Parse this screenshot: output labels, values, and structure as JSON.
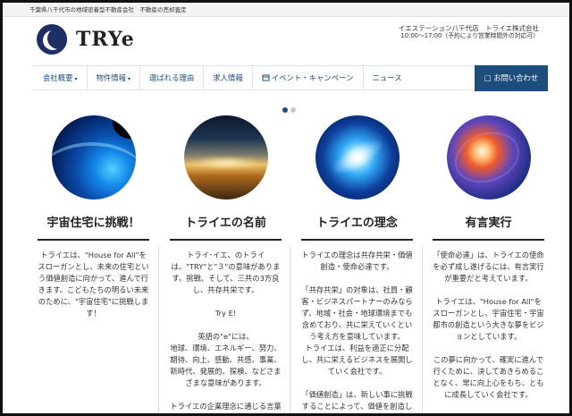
{
  "topbar": {
    "text": "千葉県八千代市の地域密着型不動産会社　不動産の売却査定"
  },
  "header": {
    "logo_text": "TRYe",
    "company_line1": "イエステーション八千代店　トライエ株式会社",
    "company_line2": "10:00～17:00（予約により営業時間外の対応可）"
  },
  "nav": {
    "items": [
      {
        "label": "会社概要",
        "caret": "▾"
      },
      {
        "label": "物件情報",
        "caret": "▾"
      },
      {
        "label": "選ばれる理由"
      },
      {
        "label": "求人情報"
      },
      {
        "label": "イベント・キャンペーン"
      },
      {
        "label": "ニュース"
      }
    ],
    "contact_label": "□ お問い合わせ"
  },
  "icons": {
    "calendar": "calendar-icon",
    "mail": "mail-icon"
  },
  "slider": {
    "active_index": 0
  },
  "columns": [
    {
      "title": "宇宙住宅に挑戦！",
      "body": "トライエは、\"House for All\"をスローガンとし、未来の住宅という価値創造に向かって、進んで行きます。こどもたちの明るい未来のために、\"宇宙住宅\"に挑戦します！"
    },
    {
      "title": "トライエの名前",
      "body": "トライ･イエ、のトライは、\"TRY\"と\"３\"の意味があります。挑戦、そして、三共の3方良し、共存共栄です。\n\nTry E!\n\n英語の\"e\"には、\n地球、環境、エネルギー、努力、期待、向上、感動、共感、事業、新時代、発展的、探検、などさまざまな意味があります。\n\nトライエの企業理念に通じる言葉の数多くが、\"e\"にあります。"
    },
    {
      "title": "トライエの理念",
      "body": "トライエの理念は共存共栄・価値創造・使命必達です。\n\n「共存共栄」の対象は、社員・顧客・ビジネスパートナーのみならず、地域・社会・地球環境までも含めており、共に栄えていくという考え方を意味しています。\nトライエは、利益を適正に分配し、共に栄えるビジネスを展開していく会社です。\n\n「価値創造」は、新しい事に挑戦することによって、価値を創造していくことを意味しています。人類"
    },
    {
      "title": "有言実行",
      "body": "「使命必達」は、トライエの使命を必ず成し遂げるには、有言実行が重要だと考えています。\n\nトライエは、\"House for All\"をスローガンとし、宇宙住宅・宇宙都市の創造という大きな夢をビジョンとしています。\n\nこの夢に向かって、確実に進んで行くために、決してあきらめることなく、常に向上心をもち、ともに成長していく会社です。"
    }
  ]
}
